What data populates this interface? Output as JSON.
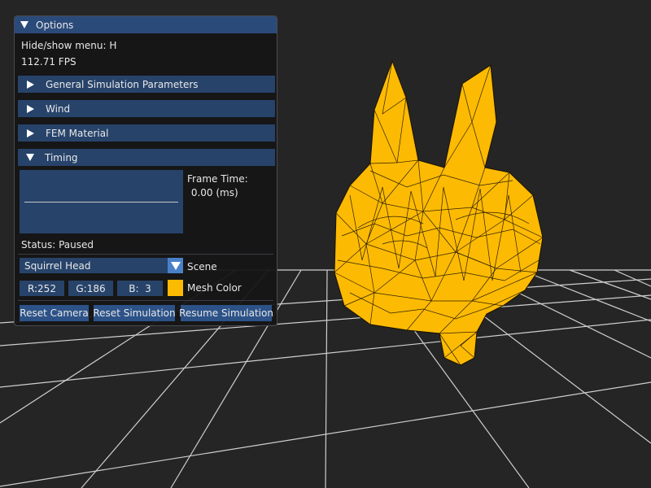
{
  "scene": {
    "grid_color": "#c8c8c8",
    "background": "#252525",
    "object": "squirrel-head-wireframe-mesh"
  },
  "panel": {
    "title": "Options",
    "hide_show_hint": "Hide/show menu: H",
    "fps": "112.71 FPS",
    "sections": [
      {
        "label": "General Simulation Parameters",
        "expanded": false
      },
      {
        "label": "Wind",
        "expanded": false
      },
      {
        "label": "FEM Material",
        "expanded": false
      },
      {
        "label": "Timing",
        "expanded": true
      }
    ],
    "timing": {
      "frame_time_label": "Frame Time:",
      "frame_time_value": " 0.00 (ms)"
    },
    "status": "Status: Paused",
    "scene_select": {
      "value": "Squirrel Head",
      "label": "Scene"
    },
    "mesh_color": {
      "r": "R:252",
      "g": "G:186",
      "b": "B:  3",
      "label": "Mesh Color",
      "hex": "#fcba03"
    },
    "buttons": {
      "reset_camera": "Reset Camera",
      "reset_simulation": "Reset Simulation",
      "resume_simulation": "Resume Simulation"
    }
  }
}
